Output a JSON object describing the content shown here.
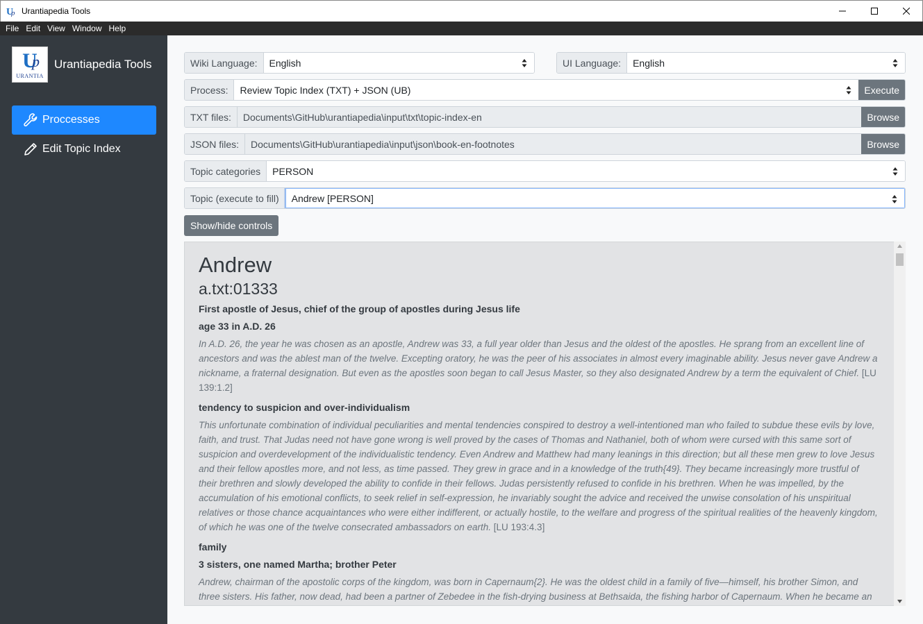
{
  "window": {
    "title": "Urantiapedia Tools"
  },
  "menu": [
    "File",
    "Edit",
    "View",
    "Window",
    "Help"
  ],
  "sidebar": {
    "brand": "Urantiapedia Tools",
    "logo": {
      "main": "U",
      "p": "p",
      "sub": "URANTIA"
    },
    "items": [
      {
        "label": "Proccesses",
        "icon": "wrench-icon",
        "active": true
      },
      {
        "label": "Edit Topic Index",
        "icon": "pencil-icon",
        "active": false
      }
    ]
  },
  "controls": {
    "wiki_language": {
      "label": "Wiki Language:",
      "value": "English"
    },
    "ui_language": {
      "label": "UI Language:",
      "value": "English"
    },
    "process": {
      "label": "Process:",
      "value": "Review Topic Index (TXT) + JSON (UB)",
      "button": "Execute"
    },
    "txt_files": {
      "label": "TXT files:",
      "value": "Documents\\GitHub\\urantiapedia\\input\\txt\\topic-index-en",
      "button": "Browse"
    },
    "json_files": {
      "label": "JSON files:",
      "value": "Documents\\GitHub\\urantiapedia\\input\\json\\book-en-footnotes",
      "button": "Browse"
    },
    "topic_categories": {
      "label": "Topic categories",
      "value": "PERSON"
    },
    "topic": {
      "label": "Topic (execute to fill)",
      "value": "Andrew [PERSON]"
    },
    "toggle": "Show/hide controls"
  },
  "content": {
    "title": "Andrew",
    "subtitle": "a.txt:01333",
    "blocks": [
      {
        "type": "bold",
        "text": "First apostle of Jesus, chief of the group of apostles during Jesus life"
      },
      {
        "type": "bold",
        "text": "age 33 in A.D. 26"
      },
      {
        "type": "para",
        "text": "In A.D. 26, the year he was chosen as an apostle, Andrew was 33, a full year older than Jesus and the oldest of the apostles. He sprang from an excellent line of ancestors and was the ablest man of the twelve. Excepting oratory, he was the peer of his associates in almost every imaginable ability. Jesus never gave Andrew a nickname, a fraternal designation. But even as the apostles soon began to call Jesus Master, so they also designated Andrew by a term the equivalent of Chief.",
        "ref": "[LU 139:1.2]"
      },
      {
        "type": "bold",
        "text": "tendency to suspicion and over-individualism"
      },
      {
        "type": "para",
        "text": "This unfortunate combination of individual peculiarities and mental tendencies conspired to destroy a well-intentioned man who failed to subdue these evils by love, faith, and trust. That Judas need not have gone wrong is well proved by the cases of Thomas and Nathaniel, both of whom were cursed with this same sort of suspicion and overdevelopment of the individualistic tendency. Even Andrew and Matthew had many leanings in this direction; but all these men grew to love Jesus and their fellow apostles more, and not less, as time passed. They grew in grace and in a knowledge of the truth{49}. They became increasingly more trustful of their brethren and slowly developed the ability to confide in their fellows. Judas persistently refused to confide in his brethren. When he was impelled, by the accumulation of his emotional conflicts, to seek relief in self-expression, he invariably sought the advice and received the unwise consolation of his unspiritual relatives or those chance acquaintances who were either indifferent, or actually hostile, to the welfare and progress of the spiritual realities of the heavenly kingdom, of which he was one of the twelve consecrated ambassadors on earth.",
        "ref": "[LU 193:4.3]"
      },
      {
        "type": "bold",
        "text": "family"
      },
      {
        "type": "bold",
        "text": "3 sisters, one named Martha; brother Peter"
      },
      {
        "type": "para",
        "text": "Andrew, chairman of the apostolic corps of the kingdom, was born in Capernaum{2}. He was the oldest child in a family of five—himself, his brother Simon, and three sisters. His father, now dead, had been a partner of Zebedee in the fish-drying business at Bethsaida, the fishing harbor of Capernaum. When he became an",
        "ref": ""
      }
    ]
  }
}
